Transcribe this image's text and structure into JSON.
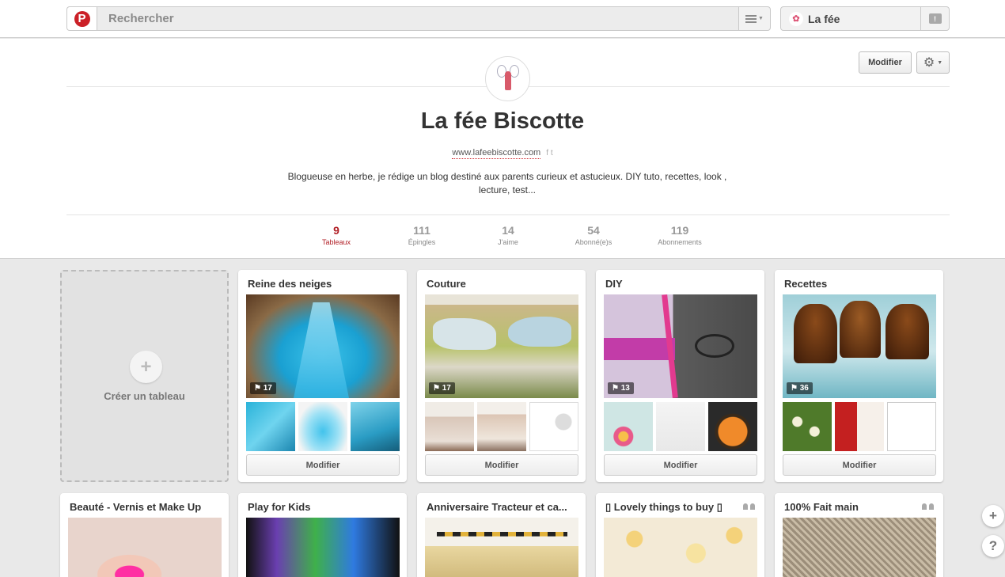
{
  "header": {
    "logo_letter": "P",
    "search_placeholder": "Rechercher",
    "user_label": "La fée",
    "notif_glyph": "!"
  },
  "profile": {
    "edit_label": "Modifier",
    "name": "La fée Biscotte",
    "website": "www.lafeebiscotte.com",
    "social_glyph": "f t",
    "bio": "Blogueuse en herbe, je rédige un blog destiné aux parents curieux et astucieux. DIY tuto, recettes, look , lecture, test..."
  },
  "stats": [
    {
      "value": "9",
      "label": "Tableaux",
      "active": true
    },
    {
      "value": "111",
      "label": "Épingles",
      "active": false
    },
    {
      "value": "14",
      "label": "J'aime",
      "active": false
    },
    {
      "value": "54",
      "label": "Abonné(e)s",
      "active": false
    },
    {
      "value": "119",
      "label": "Abonnements",
      "active": false
    }
  ],
  "create_board": {
    "plus": "+",
    "label": "Créer un tableau"
  },
  "boards": [
    {
      "title": "Reine des neiges",
      "count": "17",
      "edit": "Modifier"
    },
    {
      "title": "Couture",
      "count": "17",
      "edit": "Modifier"
    },
    {
      "title": "DIY",
      "count": "13",
      "edit": "Modifier"
    },
    {
      "title": "Recettes",
      "count": "36",
      "edit": "Modifier"
    },
    {
      "title": "Beauté - Vernis et Make Up"
    },
    {
      "title": "Play for Kids"
    },
    {
      "title": "Anniversaire Tracteur et ca..."
    },
    {
      "title": "▯ Lovely things to buy ▯"
    },
    {
      "title": "100% Fait main"
    }
  ],
  "pin_glyph": "⚑",
  "float": {
    "add": "+",
    "help": "?"
  },
  "colors": {
    "accent": "#cb2027",
    "active_stat": "#b11e25",
    "background": "#e9e9e9"
  }
}
